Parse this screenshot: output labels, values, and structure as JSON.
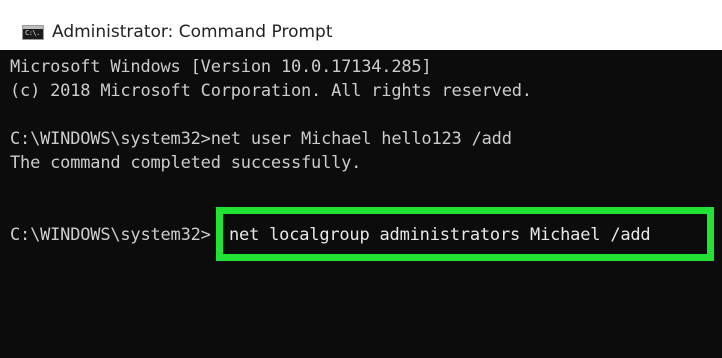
{
  "window": {
    "title": "Administrator: Command Prompt",
    "app_icon": "cmd-icon",
    "app_icon_glyph": "C:\\."
  },
  "console": {
    "lines": [
      "Microsoft Windows [Version 10.0.17134.285]",
      "(c) 2018 Microsoft Corporation. All rights reserved.",
      "C:\\WINDOWS\\system32>net user Michael hello123 /add",
      "The command completed successfully."
    ],
    "prompt": "C:\\WINDOWS\\system32>",
    "current_command": "net localgroup administrators Michael /add"
  },
  "colors": {
    "console_background": "#0c0c0c",
    "console_text": "#cccccc",
    "highlight_border": "#22e334",
    "titlebar_background": "#ffffff"
  }
}
